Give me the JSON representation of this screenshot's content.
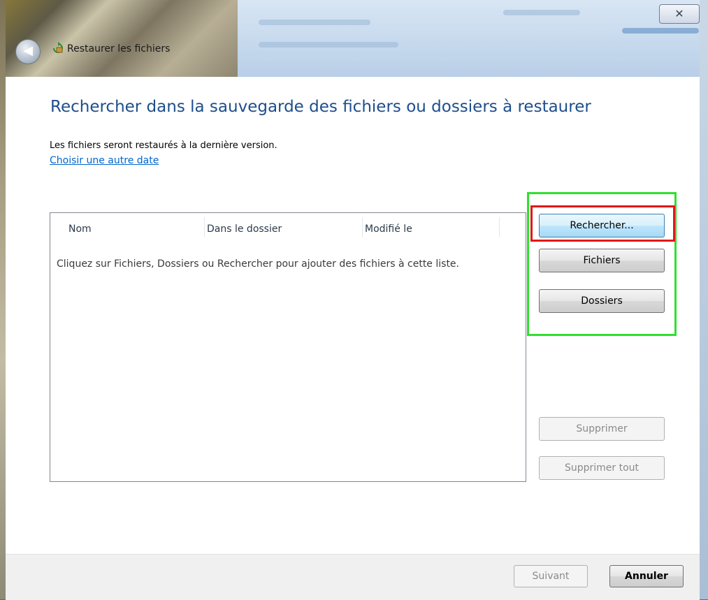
{
  "window": {
    "title": "Restaurer les fichiers",
    "close_glyph": "✕",
    "back_glyph": "◀",
    "title_icon": "restore-files-icon"
  },
  "page": {
    "heading": "Rechercher dans la sauvegarde des fichiers ou dossiers à restaurer",
    "info": "Les fichiers seront restaurés à la dernière version.",
    "choose_date_link": "Choisir une autre date"
  },
  "file_list": {
    "columns": [
      "Nom",
      "Dans le dossier",
      "Modifié le"
    ],
    "empty_message": "Cliquez sur Fichiers, Dossiers ou Rechercher pour ajouter des fichiers à cette liste."
  },
  "actions": {
    "search": "Rechercher...",
    "files": "Fichiers",
    "folders": "Dossiers",
    "remove": "Supprimer",
    "remove_all": "Supprimer tout"
  },
  "footer": {
    "next": "Suivant",
    "cancel": "Annuler"
  },
  "colors": {
    "heading": "#1e4e8c",
    "link": "#0066cc",
    "highlight_green": "#2ee02e",
    "highlight_red": "#e01818"
  }
}
